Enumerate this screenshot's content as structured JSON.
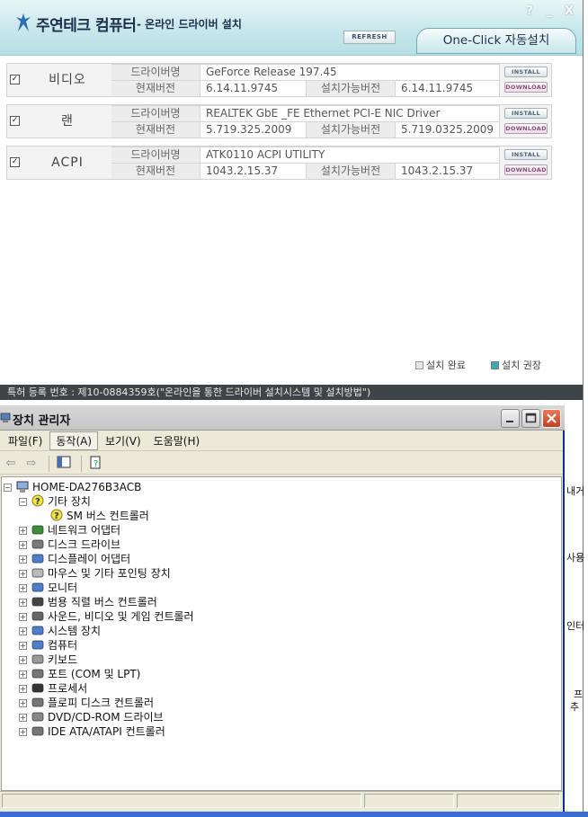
{
  "installer": {
    "brand": "주연테크 컴퓨터",
    "subtitle": "- 온라인 드라이버 설치",
    "refresh_label": "REFRESH",
    "oneclick_label": "One-Click 자동설치",
    "window_controls": [
      "?",
      "_",
      "X"
    ],
    "label_driver_name": "드라이버명",
    "label_current_version": "현재버전",
    "label_installable_version": "설치가능버전",
    "install_label": "INSTALL",
    "download_label": "DOWNLOAD",
    "drivers": [
      {
        "category": "비디오",
        "name": "GeForce Release 197.45",
        "current": "6.14.11.9745",
        "available": "6.14.11.9745"
      },
      {
        "category": "랜",
        "name": "REALTEK GbE _FE Ethernet PCI-E NIC Driver",
        "current": "5.719.325.2009",
        "available": "5.719.0325.2009"
      },
      {
        "category": "ACPI",
        "name": "ATK0110 ACPI UTILITY",
        "current": "1043.2.15.37",
        "available": "1043.2.15.37"
      }
    ],
    "legend": {
      "done_label": "설치 완료",
      "recommended_label": "설치 권장",
      "done_color": "#e6e6e6",
      "recommended_color": "#3eaab4"
    },
    "patent_text": "특허 등록 번호 : 제10-0884359호(\"온라인을 통한 드라이버 설치시스템 및 설치방법\")"
  },
  "device_manager": {
    "title": "장치 관리자",
    "menu": [
      "파일(F)",
      "동작(A)",
      "보기(V)",
      "도움말(H)"
    ],
    "active_menu_index": 1,
    "root": "HOME-DA276B3ACB",
    "other_devices": "기타 장치",
    "other_child": "SM 버스 컨트롤러",
    "categories": [
      {
        "label": "네트워크 어댑터",
        "icon": "network-adapter-icon"
      },
      {
        "label": "디스크 드라이브",
        "icon": "disk-drive-icon"
      },
      {
        "label": "디스플레이 어댑터",
        "icon": "display-adapter-icon"
      },
      {
        "label": "마우스 및 기타 포인팅 장치",
        "icon": "mouse-icon"
      },
      {
        "label": "모니터",
        "icon": "monitor-icon"
      },
      {
        "label": "범용 직렬 버스 컨트롤러",
        "icon": "usb-icon"
      },
      {
        "label": "사운드, 비디오 및 게임 컨트롤러",
        "icon": "sound-icon"
      },
      {
        "label": "시스템 장치",
        "icon": "system-device-icon"
      },
      {
        "label": "컴퓨터",
        "icon": "computer-icon"
      },
      {
        "label": "키보드",
        "icon": "keyboard-icon"
      },
      {
        "label": "포트 (COM 및 LPT)",
        "icon": "port-icon"
      },
      {
        "label": "프로세서",
        "icon": "processor-icon"
      },
      {
        "label": "플로피 디스크 컨트롤러",
        "icon": "floppy-controller-icon"
      },
      {
        "label": "DVD/CD-ROM 드라이브",
        "icon": "dvd-drive-icon"
      },
      {
        "label": "IDE ATA/ATAPI 컨트롤러",
        "icon": "ide-controller-icon"
      }
    ]
  },
  "side_labels": [
    "내거",
    "사용",
    "인터",
    "프",
    "추"
  ]
}
